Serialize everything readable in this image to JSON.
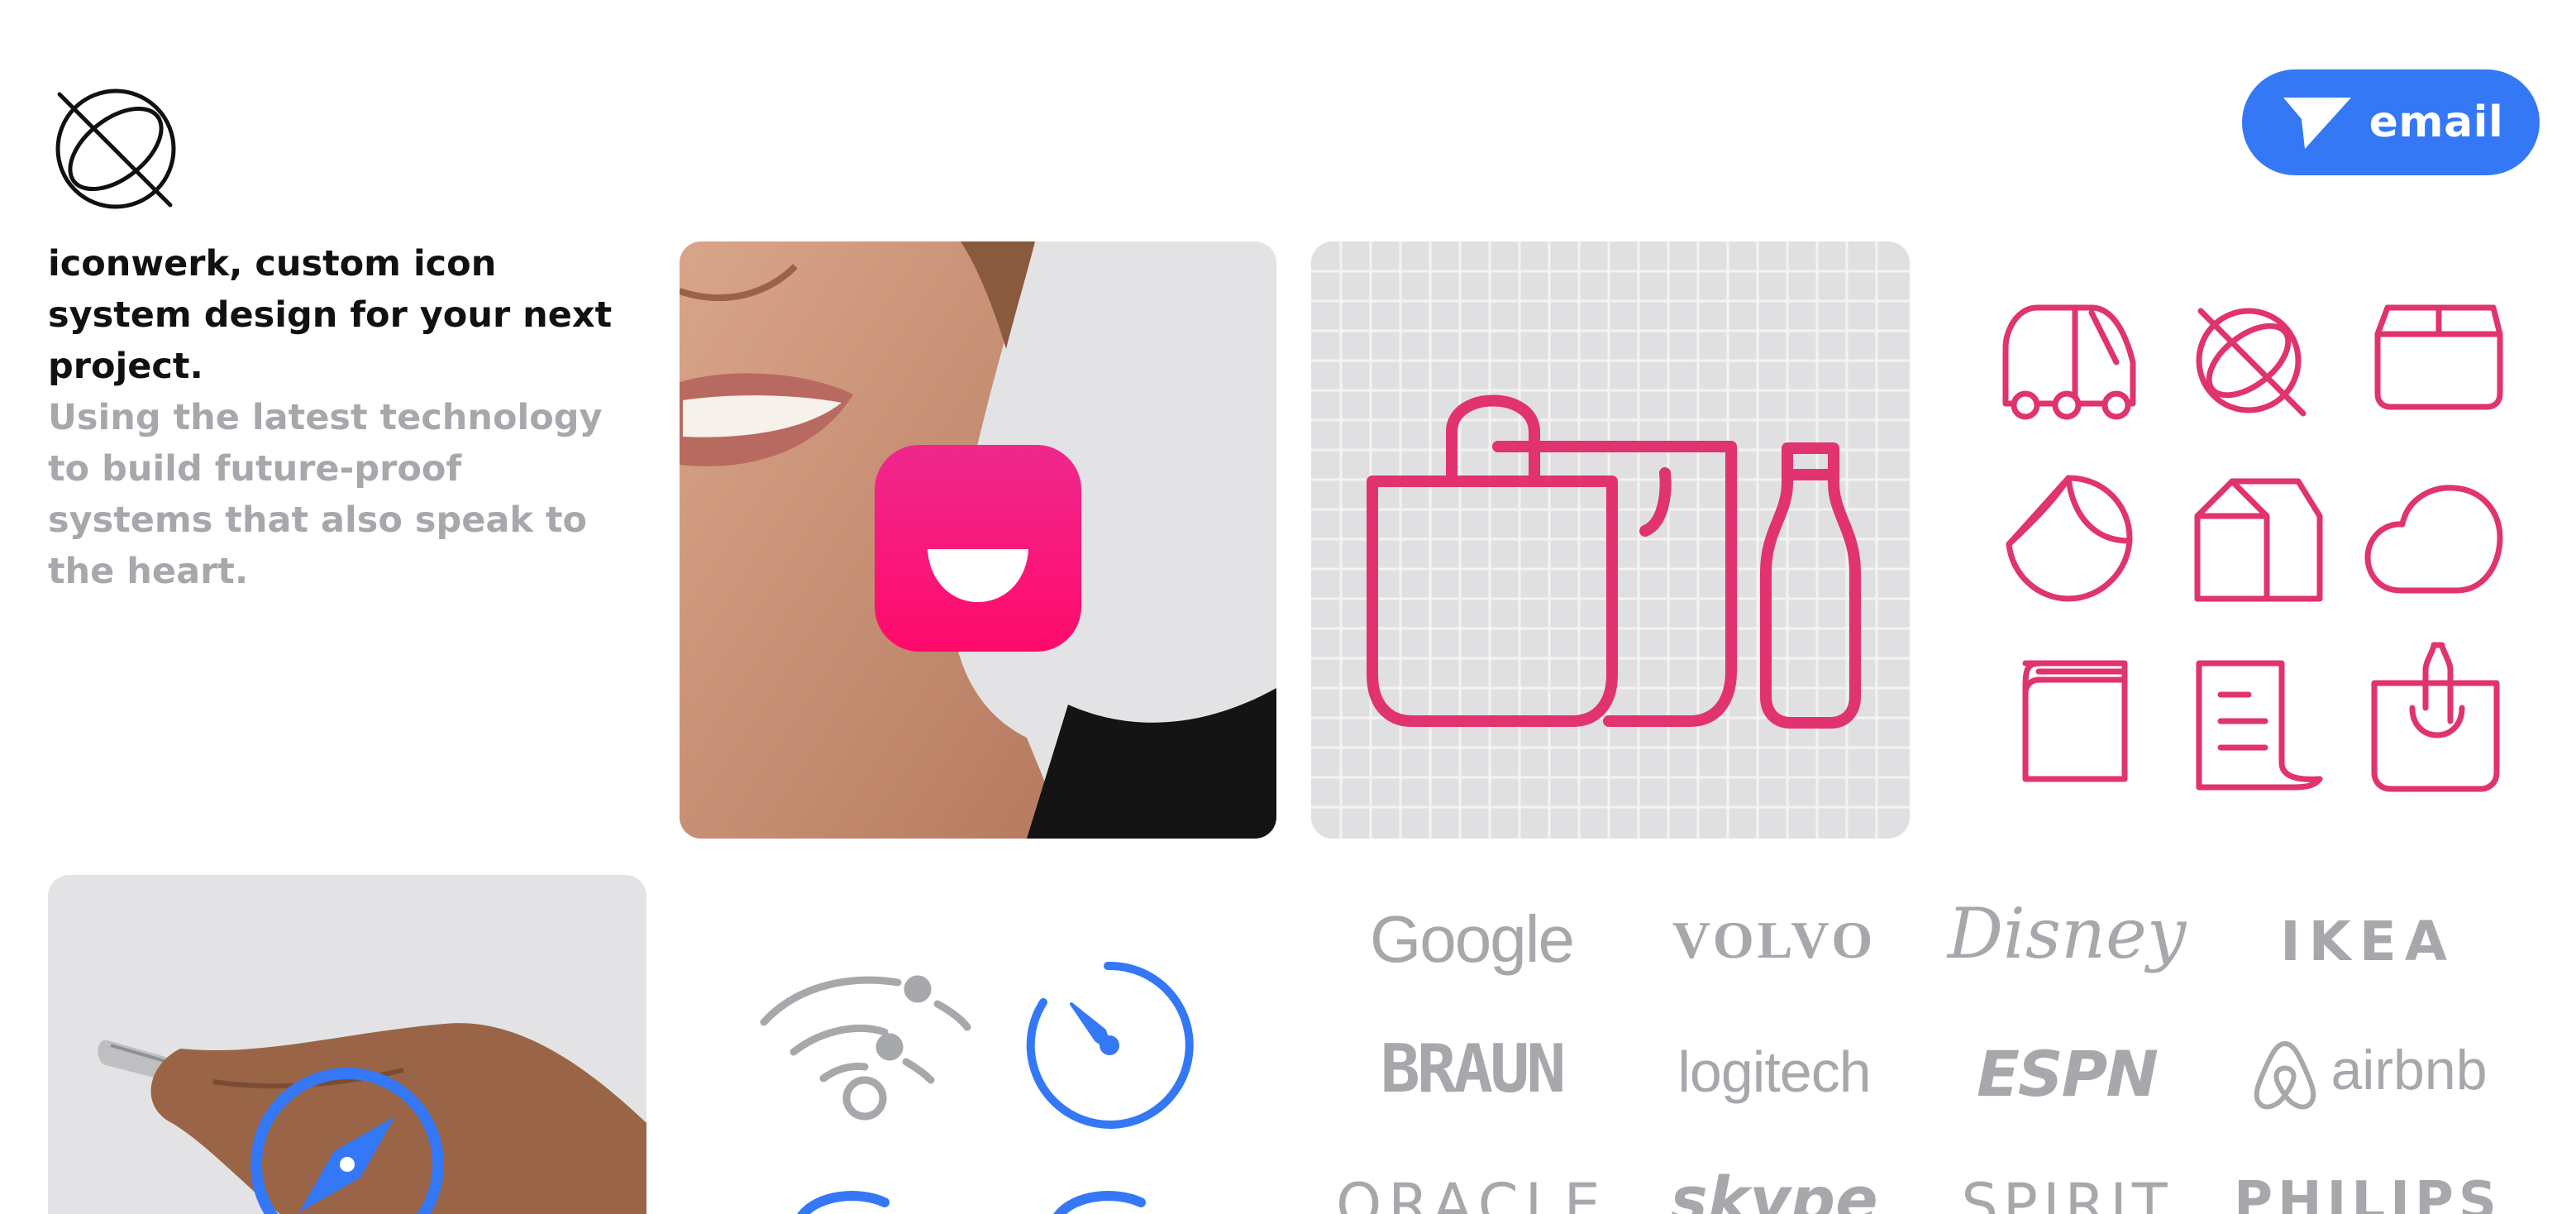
{
  "header": {
    "email_label": "email"
  },
  "intro": {
    "headline": "iconwerk, custom icon system design for your next project.",
    "body": "Using the latest technology to build future-proof systems that also speak to the heart."
  },
  "brands": {
    "google": "Google",
    "volvo": "VOLVO",
    "disney": "Disney",
    "ikea": "IKEA",
    "braun": "BRAUN",
    "logitech": "logitech",
    "espn": "ESPN",
    "airbnb": "airbnb",
    "oracle": "ORACLE",
    "skype": "skype",
    "spirit": "SPIRIT",
    "philips": "PHILIPS"
  },
  "colors": {
    "accent_blue": "#3478f6",
    "icon_pink": "#e0336f",
    "brand_gray": "#a7a8ac",
    "tile_gray": "#e3e3e5"
  },
  "icons": [
    "logo-icon",
    "send-icon",
    "smile-app-icon",
    "shopping-bags-icon",
    "van-icon",
    "logo-mark-icon",
    "box-icon",
    "sticker-icon",
    "house-icon",
    "cloud-icon",
    "book-icon",
    "receipt-icon",
    "bag-bottle-icon",
    "wifi-icon",
    "timer-icon",
    "compass-icon"
  ]
}
